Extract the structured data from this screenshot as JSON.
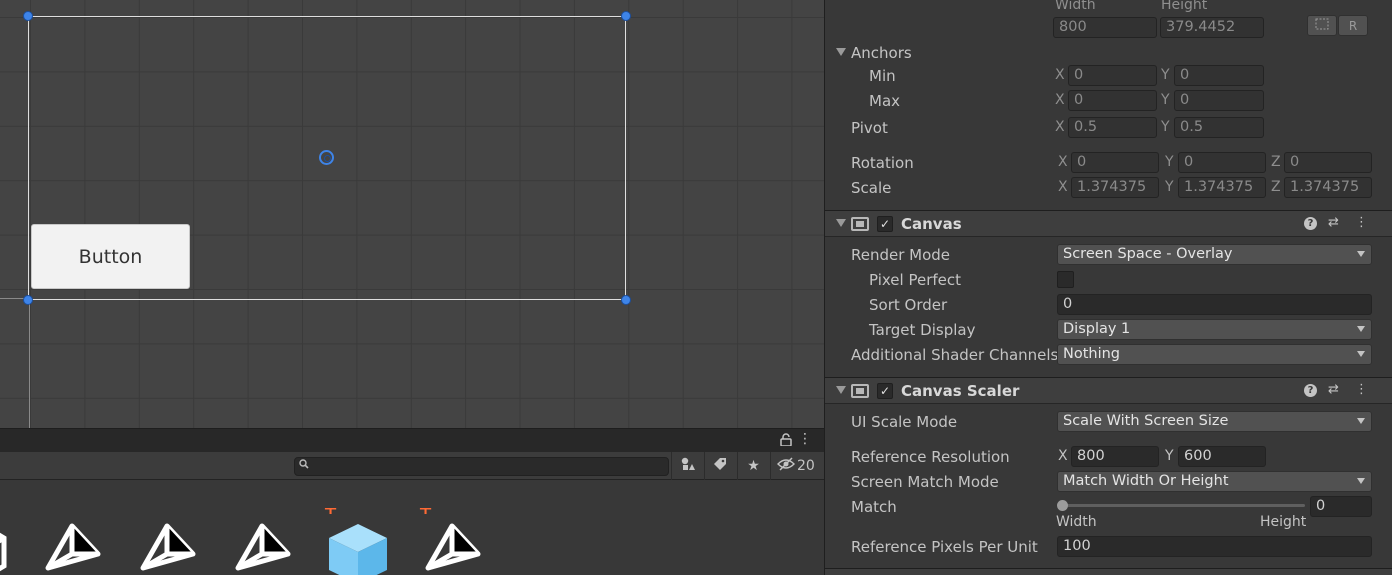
{
  "scene": {
    "button_label": "Button"
  },
  "project": {
    "search": {
      "placeholder": ""
    },
    "visible_count": "20",
    "toolbar_icons": [
      "lock-icon",
      "kebab-menu-icon",
      "search-icon",
      "filter-by-type-icon",
      "filter-by-label-icon",
      "favorite-star-icon",
      "hidden-packages-eye-icon"
    ],
    "assets": [
      {
        "icon": "unity-logo-icon",
        "new": false
      },
      {
        "icon": "unity-logo-icon",
        "new": false
      },
      {
        "icon": "unity-logo-icon",
        "new": false
      },
      {
        "icon": "unity-logo-icon",
        "new": false
      },
      {
        "icon": "prefab-cube-icon",
        "new": true
      },
      {
        "icon": "unity-logo-icon",
        "new": true
      }
    ]
  },
  "inspector": {
    "rect_transform": {
      "width_label": "Width",
      "height_label": "Height",
      "width": "800",
      "height": "379.4452",
      "anchors_label": "Anchors",
      "min_label": "Min",
      "max_label": "Max",
      "min": {
        "x": "0",
        "y": "0"
      },
      "max": {
        "x": "0",
        "y": "0"
      },
      "pivot_label": "Pivot",
      "pivot": {
        "x": "0.5",
        "y": "0.5"
      },
      "rotation_label": "Rotation",
      "rotation": {
        "x": "0",
        "y": "0",
        "z": "0"
      },
      "scale_label": "Scale",
      "scale": {
        "x": "1.374375",
        "y": "1.374375",
        "z": "1.374375"
      }
    },
    "canvas": {
      "title": "Canvas",
      "enabled": "✓",
      "render_mode_label": "Render Mode",
      "render_mode": "Screen Space - Overlay",
      "pixel_perfect_label": "Pixel Perfect",
      "sort_order_label": "Sort Order",
      "sort_order": "0",
      "target_display_label": "Target Display",
      "target_display": "Display 1",
      "shader_channels_label": "Additional Shader Channels",
      "shader_channels": "Nothing"
    },
    "canvas_scaler": {
      "title": "Canvas Scaler",
      "enabled": "✓",
      "ui_scale_mode_label": "UI Scale Mode",
      "ui_scale_mode": "Scale With Screen Size",
      "ref_resolution_label": "Reference Resolution",
      "ref_resolution": {
        "x": "800",
        "y": "600"
      },
      "screen_match_mode_label": "Screen Match Mode",
      "screen_match_mode": "Match Width Or Height",
      "match_label": "Match",
      "match_value": "0",
      "match_fraction": 0,
      "match_left_label": "Width",
      "match_right_label": "Height",
      "ref_ppu_label": "Reference Pixels Per Unit",
      "ref_ppu": "100"
    },
    "axis": {
      "x": "X",
      "y": "Y",
      "z": "Z"
    }
  },
  "colors": {
    "handle_blue": "#3e84e8",
    "new_asset_plus": "#ff6a35",
    "prefab_cube": "#7ecbf5"
  }
}
